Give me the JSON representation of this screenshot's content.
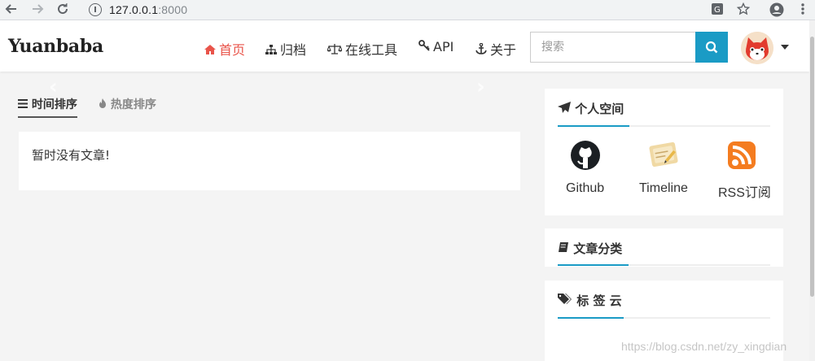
{
  "browser": {
    "url_host": "127.0.0.1",
    "url_port": ":8000"
  },
  "navbar": {
    "brand": "Yuanbaba",
    "items": [
      {
        "label": "首页",
        "icon": "home-icon",
        "active": true
      },
      {
        "label": "归档",
        "icon": "sitemap-icon",
        "active": false
      },
      {
        "label": "在线工具",
        "icon": "balance-scale-icon",
        "active": false
      },
      {
        "label": "API",
        "icon": "key-icon",
        "active": false
      },
      {
        "label": "关于",
        "icon": "anchor-icon",
        "active": false
      }
    ],
    "search_placeholder": "搜索"
  },
  "main": {
    "tabs": [
      {
        "label": "时间排序",
        "active": true
      },
      {
        "label": "热度排序",
        "active": false
      }
    ],
    "empty_message": "暂时没有文章!"
  },
  "sidebar": {
    "personal": {
      "title": "个人空间",
      "links": [
        {
          "label": "Github",
          "icon": "github-icon"
        },
        {
          "label": "Timeline",
          "icon": "timeline-icon"
        },
        {
          "label": "RSS订阅",
          "icon": "rss-icon"
        }
      ]
    },
    "categories": {
      "title": "文章分类"
    },
    "tags": {
      "title": "标 签 云"
    }
  },
  "watermark": "https://blog.csdn.net/zy_xingdian",
  "colors": {
    "accent": "#1a9bc5",
    "active_nav": "#e9544a",
    "background": "#f4f4f4"
  }
}
